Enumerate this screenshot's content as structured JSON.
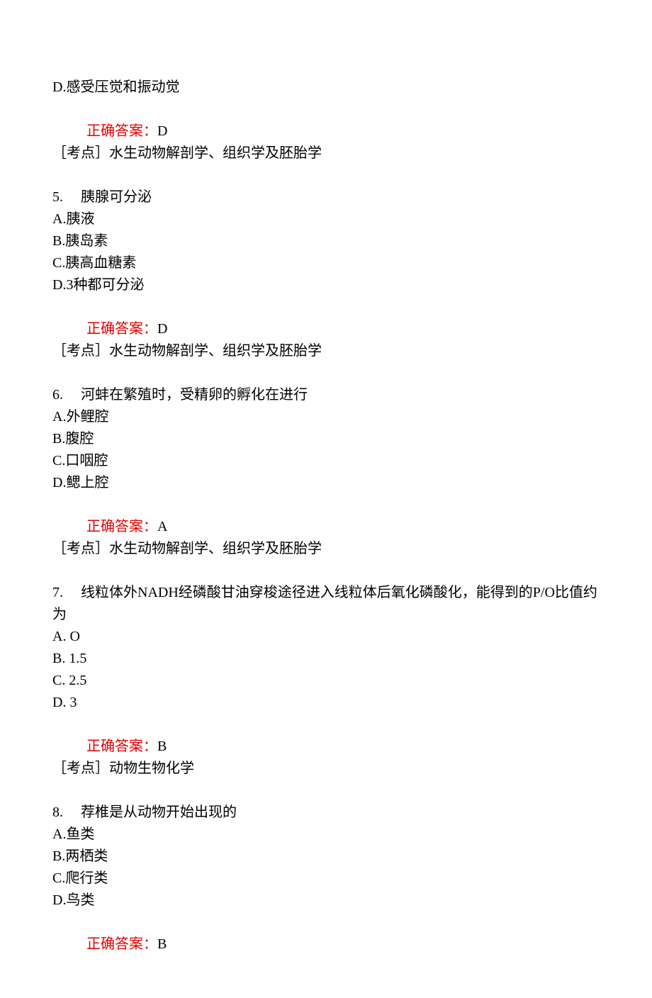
{
  "q4": {
    "optD": "D.感受压觉和振动觉",
    "answer_label": "正确答案：",
    "answer_value": "D",
    "topic": "［考点］水生动物解剖学、组织学及胚胎学"
  },
  "q5": {
    "stem": "5.　 胰腺可分泌",
    "optA": "A.胰液",
    "optB": "B.胰岛素",
    "optC": "C.胰高血糖素",
    "optD": "D.3种都可分泌",
    "answer_label": "正确答案：",
    "answer_value": "D",
    "topic": "［考点］水生动物解剖学、组织学及胚胎学"
  },
  "q6": {
    "stem": "6.　 河蚌在繁殖时，受精卵的孵化在进行",
    "optA": "A.外鲤腔",
    "optB": "B.腹腔",
    "optC": "C.口咽腔",
    "optD": "D.鳃上腔",
    "answer_label": "正确答案：",
    "answer_value": "A",
    "topic": "［考点］水生动物解剖学、组织学及胚胎学"
  },
  "q7": {
    "stem": "7.　 线粒体外NADH经磷酸甘油穿梭途径进入线粒体后氧化磷酸化，能得到的P/O比值约为",
    "optA": "A. O",
    "optB": "B. 1.5",
    "optC": "C. 2.5",
    "optD": "D. 3",
    "answer_label": "正确答案：",
    "answer_value": "B",
    "topic": "［考点］动物生物化学"
  },
  "q8": {
    "stem": "8.　 荐椎是从动物开始出现的",
    "optA": "A.鱼类",
    "optB": "B.两栖类",
    "optC": "C.爬行类",
    "optD": "D.鸟类",
    "answer_label": "正确答案：",
    "answer_value": "B"
  }
}
